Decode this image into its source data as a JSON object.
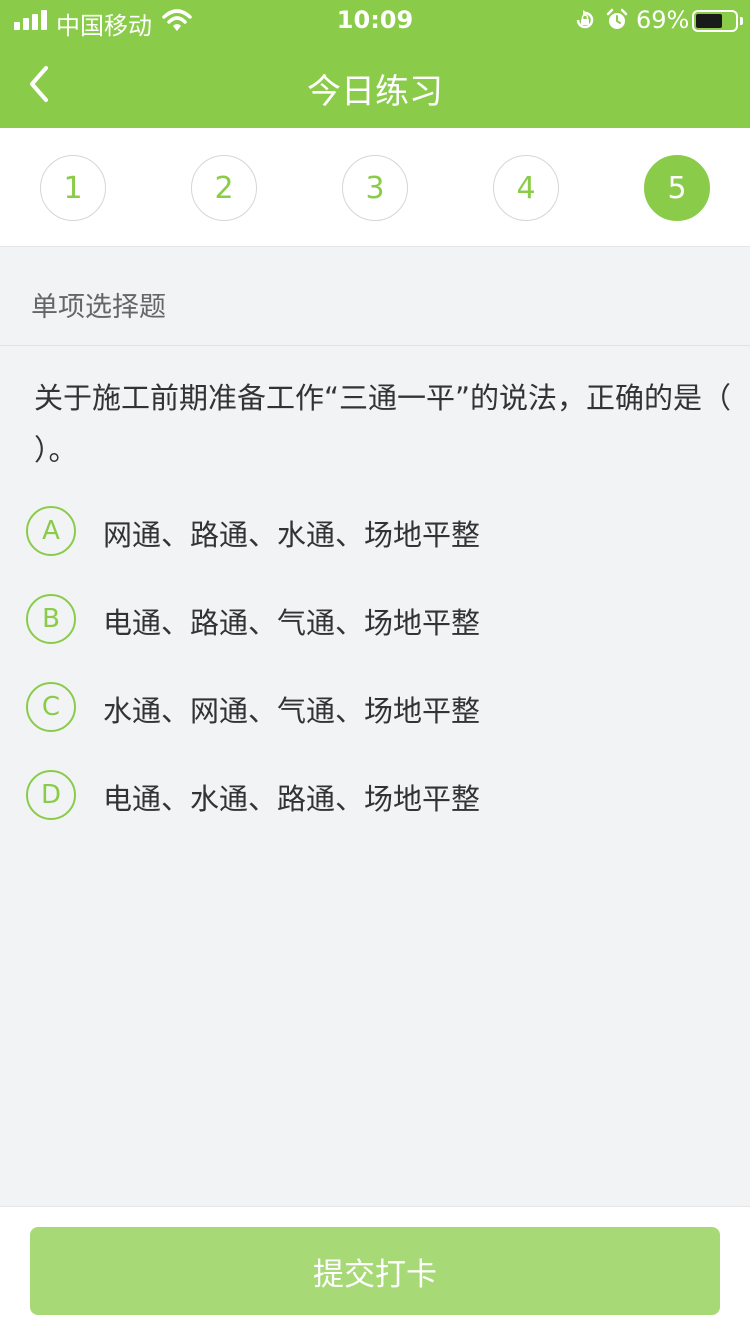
{
  "status_bar": {
    "carrier": "中国移动",
    "time": "10:09",
    "battery_percent": "69%",
    "battery_level": 0.69,
    "icons": [
      "signal-icon",
      "wifi-icon",
      "orientation-lock-icon",
      "alarm-icon",
      "battery-icon"
    ]
  },
  "header": {
    "title": "今日练习",
    "back_icon": "chevron-left-icon",
    "background": "#8acc4a"
  },
  "question_nav": {
    "items": [
      "1",
      "2",
      "3",
      "4",
      "5"
    ],
    "active_index": 4,
    "accent": "#8acc4a"
  },
  "question": {
    "type": "单项选择题",
    "text": "关于施工前期准备工作“三通一平”的说法，正确的是（ ）。",
    "options": [
      {
        "letter": "A",
        "text": "网通、路通、水通、场地平整"
      },
      {
        "letter": "B",
        "text": "电通、路通、气通、场地平整"
      },
      {
        "letter": "C",
        "text": "水通、网通、气通、场地平整"
      },
      {
        "letter": "D",
        "text": "电通、水通、路通、场地平整"
      }
    ]
  },
  "footer": {
    "submit_label": "提交打卡",
    "submit_color": "#a8d977"
  }
}
